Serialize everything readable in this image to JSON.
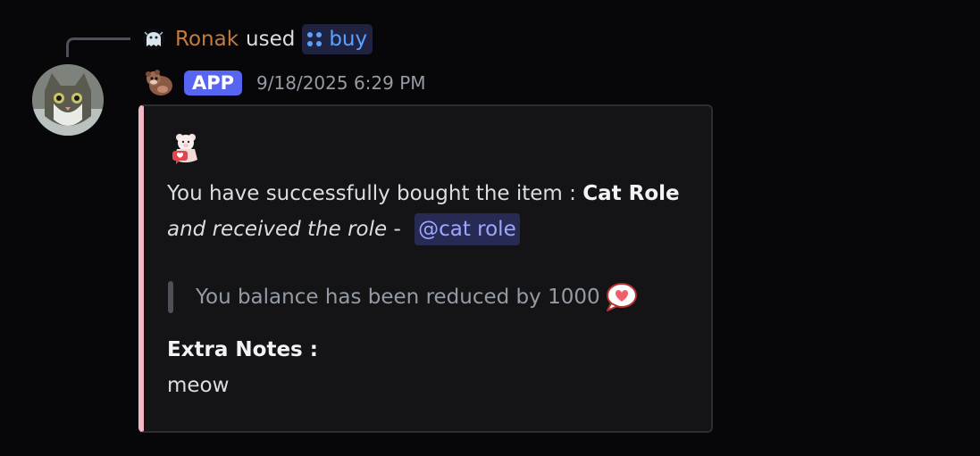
{
  "reply": {
    "username": "Ronak",
    "used_text": "used",
    "command": "buy",
    "username_color": "#c27c3e",
    "command_color": "#5aa2ff"
  },
  "header": {
    "badge": "APP",
    "timestamp": "9/18/2025 6:29 PM",
    "badge_color": "#5865f2"
  },
  "embed": {
    "accent_color": "#f4b8c4",
    "line1_prefix": "You have successfully bought the item : ",
    "item_name": "Cat Role",
    "line2_italic": "and received the role",
    "line2_dash": " - ",
    "role_mention": "@cat role",
    "quote": "You balance has been reduced by 1000",
    "notes_title": "Extra Notes :",
    "notes_body": "meow"
  },
  "icons": {
    "reply_avatar": "ghost-icon",
    "command": "slash-command-icon",
    "bot_emoji": "otter-icon",
    "embed_emoji": "bear-notification-icon",
    "quote_emoji": "heart-speech-bubble-icon"
  }
}
